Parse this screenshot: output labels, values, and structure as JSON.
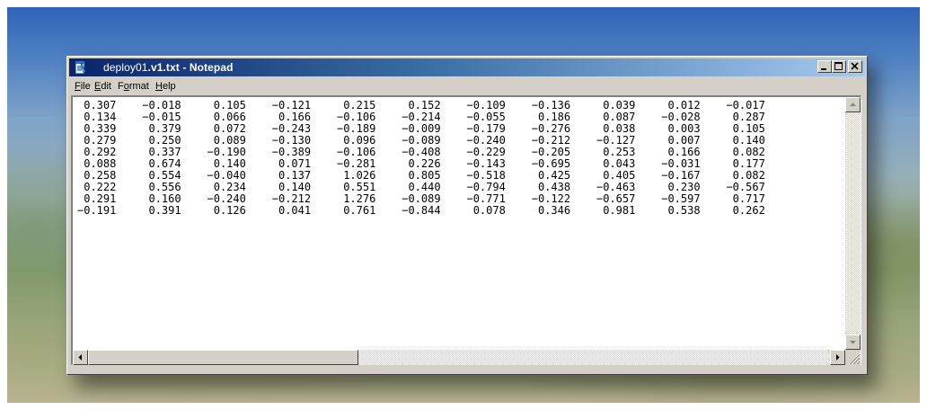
{
  "window": {
    "title_prefix": "deploy01",
    "title_strong": ".v1.txt - Notepad"
  },
  "menu": {
    "file": {
      "underline": "F",
      "rest": "ile"
    },
    "edit": {
      "underline": "E",
      "rest": "dit"
    },
    "format": {
      "pre": "F",
      "underline": "o",
      "rest": "rmat"
    },
    "help": {
      "underline": "H",
      "rest": "elp"
    }
  },
  "icons": {
    "app": "notepad-icon",
    "minimize": "minimize-icon",
    "maximize": "maximize-icon",
    "close": "close-icon",
    "scroll_up": "arrow-up-icon",
    "scroll_down": "arrow-down-icon",
    "scroll_left": "arrow-left-icon",
    "scroll_right": "arrow-right-icon",
    "size_grip": "size-grip-icon"
  },
  "document": {
    "rows": [
      [
        "0.307",
        "-0.018",
        "0.105",
        "-0.121",
        "0.215",
        "0.152",
        "-0.109",
        "-0.136",
        "0.039",
        "0.012",
        "-0.017"
      ],
      [
        "0.134",
        "-0.015",
        "0.066",
        "0.166",
        "-0.106",
        "-0.214",
        "-0.055",
        "0.186",
        "0.087",
        "-0.028",
        "0.287"
      ],
      [
        "0.339",
        "0.379",
        "0.072",
        "-0.243",
        "-0.189",
        "-0.009",
        "-0.179",
        "-0.276",
        "0.038",
        "0.003",
        "0.105"
      ],
      [
        "0.279",
        "0.250",
        "0.089",
        "-0.130",
        "0.096",
        "-0.089",
        "-0.240",
        "-0.212",
        "-0.127",
        "0.007",
        "0.140"
      ],
      [
        "0.292",
        "0.337",
        "-0.190",
        "-0.389",
        "-0.106",
        "-0.408",
        "-0.229",
        "-0.205",
        "0.253",
        "0.166",
        "0.082"
      ],
      [
        "0.088",
        "0.674",
        "0.140",
        "0.071",
        "-0.281",
        "0.226",
        "-0.143",
        "-0.695",
        "0.043",
        "-0.031",
        "0.177"
      ],
      [
        "0.258",
        "0.554",
        "-0.040",
        "0.137",
        "1.026",
        "0.805",
        "-0.518",
        "0.425",
        "0.405",
        "-0.167",
        "0.082"
      ],
      [
        "0.222",
        "0.556",
        "0.234",
        "0.140",
        "0.551",
        "0.440",
        "-0.794",
        "0.438",
        "-0.463",
        "0.230",
        "-0.567"
      ],
      [
        "0.291",
        "0.160",
        "-0.240",
        "-0.212",
        "1.276",
        "-0.089",
        "-0.771",
        "-0.122",
        "-0.657",
        "-0.597",
        "0.717"
      ],
      [
        "-0.191",
        "0.391",
        "0.126",
        "0.041",
        "0.761",
        "-0.844",
        "0.078",
        "0.346",
        "0.981",
        "0.538",
        "0.262"
      ]
    ]
  }
}
